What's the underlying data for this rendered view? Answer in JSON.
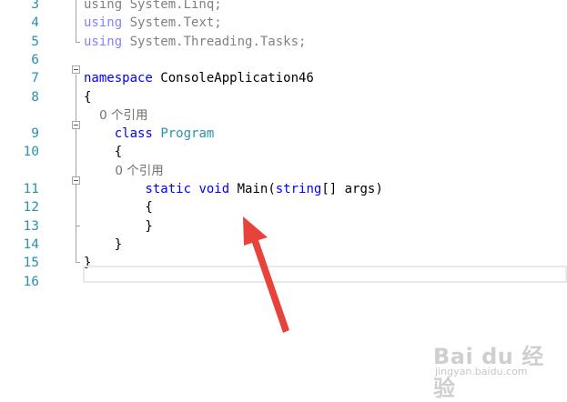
{
  "editor": {
    "lines": [
      {
        "num": "3",
        "tokens": [
          {
            "t": "using System.Linq;",
            "c": "faded"
          }
        ]
      },
      {
        "num": "4",
        "tokens": [
          {
            "t": "using",
            "c": "kw faded"
          },
          {
            "t": " System.Text;",
            "c": "faded"
          }
        ]
      },
      {
        "num": "5",
        "tokens": [
          {
            "t": "using",
            "c": "kw faded"
          },
          {
            "t": " System.Threading.Tasks;",
            "c": "faded"
          }
        ]
      },
      {
        "num": "6",
        "tokens": []
      },
      {
        "num": "7",
        "tokens": [
          {
            "t": "namespace",
            "c": "kw"
          },
          {
            "t": " ConsoleApplication46",
            "c": ""
          }
        ]
      },
      {
        "num": "8",
        "tokens": [
          {
            "t": "{",
            "c": ""
          }
        ]
      },
      {
        "num": "",
        "tokens": [
          {
            "t": "    0 个引用",
            "c": "lens"
          }
        ]
      },
      {
        "num": "9",
        "tokens": [
          {
            "t": "    ",
            "c": ""
          },
          {
            "t": "class",
            "c": "kw"
          },
          {
            "t": " ",
            "c": ""
          },
          {
            "t": "Program",
            "c": "type"
          }
        ]
      },
      {
        "num": "10",
        "tokens": [
          {
            "t": "    {",
            "c": ""
          }
        ]
      },
      {
        "num": "",
        "tokens": [
          {
            "t": "        0 个引用",
            "c": "lens"
          }
        ]
      },
      {
        "num": "11",
        "tokens": [
          {
            "t": "        ",
            "c": ""
          },
          {
            "t": "static",
            "c": "kw"
          },
          {
            "t": " ",
            "c": ""
          },
          {
            "t": "void",
            "c": "kw"
          },
          {
            "t": " Main(",
            "c": ""
          },
          {
            "t": "string",
            "c": "kw"
          },
          {
            "t": "[] args)",
            "c": ""
          }
        ]
      },
      {
        "num": "12",
        "tokens": [
          {
            "t": "        {",
            "c": ""
          }
        ]
      },
      {
        "num": "13",
        "tokens": [
          {
            "t": "        }",
            "c": ""
          }
        ]
      },
      {
        "num": "14",
        "tokens": [
          {
            "t": "    }",
            "c": ""
          }
        ]
      },
      {
        "num": "15",
        "tokens": [
          {
            "t": "}",
            "c": ""
          }
        ]
      },
      {
        "num": "16",
        "tokens": []
      }
    ]
  },
  "colors": {
    "keyword": "#0000ff",
    "type": "#2b91af",
    "line_number": "#2b91af",
    "arrow": "#e8433b"
  },
  "watermark": {
    "logo": "Bai du 经验",
    "url": "jingyan.baidu.com"
  }
}
